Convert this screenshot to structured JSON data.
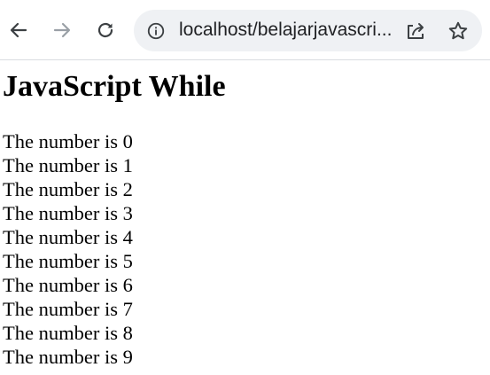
{
  "browser": {
    "address_bar": {
      "url_display": "localhost/belajarjavascri..."
    },
    "icons": {
      "back": "arrow-left-icon",
      "forward": "arrow-right-icon",
      "reload": "reload-icon",
      "site_info": "info-circle-icon",
      "share": "share-icon",
      "bookmark": "star-icon"
    },
    "colors": {
      "toolbar_background": "#ffffff",
      "omnibox_background": "#eff1f4",
      "icon_active": "#3c4043",
      "icon_disabled": "#9aa0a6"
    }
  },
  "page": {
    "heading": "JavaScript While",
    "output_lines": [
      "The number is 0",
      "The number is 1",
      "The number is 2",
      "The number is 3",
      "The number is 4",
      "The number is 5",
      "The number is 6",
      "The number is 7",
      "The number is 8",
      "The number is 9"
    ]
  }
}
